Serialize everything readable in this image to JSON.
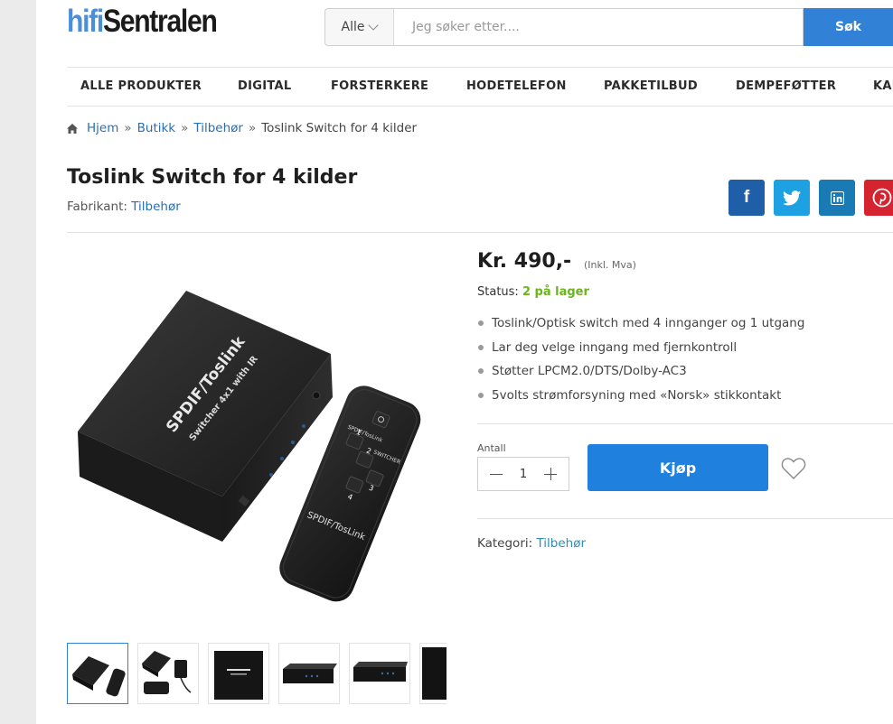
{
  "header": {
    "logo_part1": "hifi",
    "logo_part2": "Sentralen",
    "search_category": "Alle",
    "search_placeholder": "Jeg søker etter....",
    "search_button": "Søk"
  },
  "nav": {
    "items": [
      "ALLE PRODUKTER",
      "DIGITAL",
      "FORSTERKERE",
      "HODETELEFON",
      "PAKKETILBUD",
      "DEMPEFØTTER",
      "KAI"
    ]
  },
  "breadcrumb": {
    "items": [
      "Hjem",
      "Butikk",
      "Tilbehør"
    ],
    "separator": "»",
    "current": "Toslink Switch for 4 kilder"
  },
  "product": {
    "title": "Toslink Switch for 4 kilder",
    "manufacturer_label": "Fabrikant:",
    "manufacturer": "Tilbehør",
    "price": "Kr. 490,-",
    "price_note": "(Inkl. Mva)",
    "status_label": "Status:",
    "status_value": "2 på lager",
    "features": [
      "Toslink/Optisk switch med 4 innganger og 1 utgang",
      "Lar deg velge inngang med fjernkontroll",
      "Støtter LPCM2.0/DTS/Dolby-AC3",
      "5volts strømforsyning med «Norsk» stikkontakt"
    ],
    "qty_label": "Antall",
    "qty_value": "1",
    "buy_button": "Kjøp",
    "category_label": "Kategori:",
    "category": "Tilbehør",
    "image_text": {
      "box_line1": "SPDIF/Toslink",
      "box_line2": "Switcher 4x1 with IR",
      "remote_brand": "SPDIF/TosLink",
      "remote_label_a": "SPDIF/TosLink",
      "remote_label_b": "SWITCHER",
      "remote_keys": [
        "1",
        "2",
        "3",
        "4"
      ]
    }
  },
  "share": {
    "facebook": "f",
    "colors": {
      "facebook": "#1f5fa8",
      "twitter": "#1da1e2",
      "linkedin": "#1a7ab4",
      "pinterest": "#d5232f"
    }
  },
  "colors": {
    "accent": "#1f80dd",
    "link": "#2a6fb3",
    "stock": "#6bb41c"
  }
}
